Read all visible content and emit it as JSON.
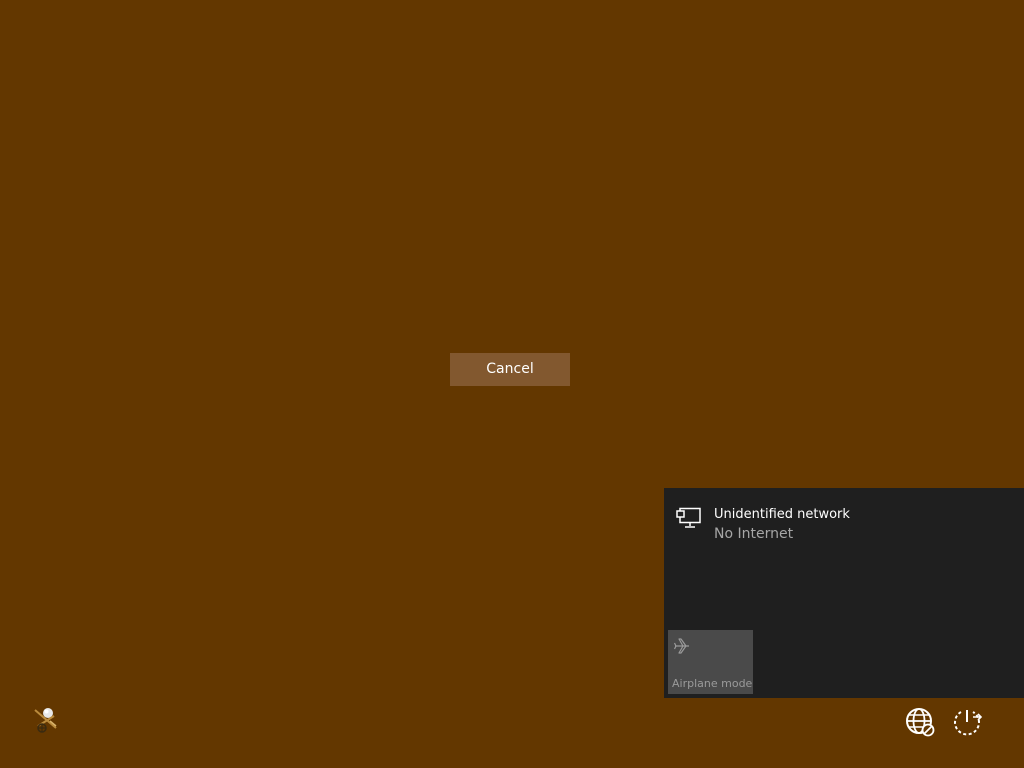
{
  "lockscreen": {
    "cancel_label": "Cancel"
  },
  "flyout": {
    "network_name": "Unidentified network",
    "network_status": "No Internet",
    "airplane_label": "Airplane mode"
  },
  "icons": {
    "user": "accessibility-user-icon",
    "network": "wired-network-icon",
    "airplane": "airplane-icon",
    "tray_network": "network-no-internet-icon",
    "tray_power": "power-icon"
  },
  "colors": {
    "background": "#633700",
    "button": "#82582f",
    "flyout": "#1f1f1f",
    "tile": "#4a4a4a"
  }
}
